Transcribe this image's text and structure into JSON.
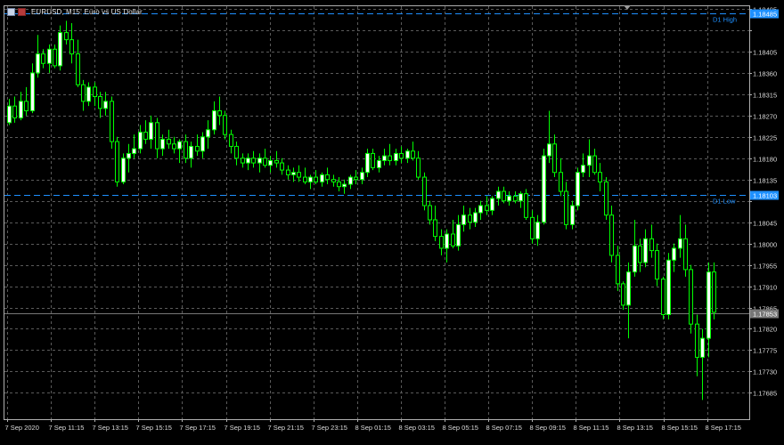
{
  "window": {
    "title": "EURUSD, M15:  Euro vs US Dollar"
  },
  "colors": {
    "background": "#000000",
    "grid": "#5a5a5a",
    "bull_candle": "#00ff00",
    "bull_body": "#ffffff",
    "bear_candle": "#00ff00",
    "axis_text": "#dcdcdc",
    "level_line": "#1e90ff",
    "level_label": "#1e90ff",
    "price_tag_bg": "#1e90ff",
    "bid_line": "#777777",
    "bid_tag_bg": "#777777"
  },
  "chart_data": {
    "type": "candlestick",
    "symbol": "EURUSD",
    "timeframe": "M15",
    "ylim": [
      1.17635,
      1.18495
    ],
    "y_ticks": [
      1.18495,
      1.1845,
      1.18405,
      1.1836,
      1.18315,
      1.1827,
      1.18225,
      1.1818,
      1.18135,
      1.1809,
      1.18045,
      1.18,
      1.17955,
      1.1791,
      1.17865,
      1.1782,
      1.17775,
      1.1773,
      1.17685
    ],
    "y_tick_labels": [
      "1.18495",
      "",
      "1.18405",
      "1.18360",
      "1.18315",
      "1.18270",
      "1.18225",
      "1.18180",
      "1.18135",
      "",
      "1.18045",
      "1.18000",
      "1.17955",
      "1.17910",
      "1.17865",
      "1.17820",
      "1.17775",
      "1.17730",
      "1.17685"
    ],
    "x_labels": [
      "7 Sep 2020",
      "7 Sep 11:15",
      "7 Sep 13:15",
      "7 Sep 15:15",
      "7 Sep 17:15",
      "7 Sep 19:15",
      "7 Sep 21:15",
      "7 Sep 23:15",
      "8 Sep 01:15",
      "8 Sep 03:15",
      "8 Sep 05:15",
      "8 Sep 07:15",
      "8 Sep 09:15",
      "8 Sep 11:15",
      "8 Sep 13:15",
      "8 Sep 15:15",
      "8 Sep 17:15"
    ],
    "grid": true,
    "levels": [
      {
        "name": "D1 High",
        "value": 1.18485,
        "label": "D1 High",
        "tag": "1.18485"
      },
      {
        "name": "D1 Low",
        "value": 1.18103,
        "label": "D1 Low",
        "tag": "1.18103"
      }
    ],
    "bid": {
      "value": 1.17853,
      "tag": "1.17853"
    },
    "candles": [
      [
        1.18255,
        1.18305,
        1.1825,
        1.1829
      ],
      [
        1.1829,
        1.1831,
        1.18255,
        1.18265
      ],
      [
        1.18265,
        1.1832,
        1.1826,
        1.183
      ],
      [
        1.183,
        1.1833,
        1.1827,
        1.1828
      ],
      [
        1.1828,
        1.1838,
        1.18275,
        1.1836
      ],
      [
        1.1836,
        1.1844,
        1.1835,
        1.184
      ],
      [
        1.184,
        1.1841,
        1.1837,
        1.1838
      ],
      [
        1.1838,
        1.1842,
        1.1836,
        1.1841
      ],
      [
        1.1841,
        1.1842,
        1.1837,
        1.18375
      ],
      [
        1.18375,
        1.1846,
        1.18365,
        1.18445
      ],
      [
        1.18445,
        1.1847,
        1.1842,
        1.1843
      ],
      [
        1.1843,
        1.18465,
        1.1838,
        1.184
      ],
      [
        1.184,
        1.1843,
        1.1833,
        1.18335
      ],
      [
        1.18335,
        1.18345,
        1.1828,
        1.183
      ],
      [
        1.183,
        1.1834,
        1.1829,
        1.1833
      ],
      [
        1.1833,
        1.1834,
        1.1829,
        1.1831
      ],
      [
        1.1831,
        1.1832,
        1.18265,
        1.18285
      ],
      [
        1.18285,
        1.1832,
        1.1827,
        1.183
      ],
      [
        1.183,
        1.1831,
        1.182,
        1.18215
      ],
      [
        1.18215,
        1.18225,
        1.1812,
        1.1813
      ],
      [
        1.1813,
        1.1819,
        1.18125,
        1.1818
      ],
      [
        1.1818,
        1.1821,
        1.1815,
        1.1819
      ],
      [
        1.1819,
        1.1823,
        1.1818,
        1.182
      ],
      [
        1.182,
        1.1825,
        1.1819,
        1.18235
      ],
      [
        1.18235,
        1.1826,
        1.1821,
        1.1822
      ],
      [
        1.1822,
        1.1827,
        1.182,
        1.18255
      ],
      [
        1.18255,
        1.18265,
        1.1818,
        1.182
      ],
      [
        1.182,
        1.1823,
        1.18185,
        1.1822
      ],
      [
        1.1822,
        1.1824,
        1.182,
        1.1821
      ],
      [
        1.1821,
        1.18225,
        1.1819,
        1.182
      ],
      [
        1.182,
        1.1822,
        1.1817,
        1.18215
      ],
      [
        1.18215,
        1.1823,
        1.1817,
        1.1818
      ],
      [
        1.1818,
        1.18215,
        1.1816,
        1.18205
      ],
      [
        1.18205,
        1.1823,
        1.18185,
        1.18195
      ],
      [
        1.18195,
        1.18235,
        1.1818,
        1.18225
      ],
      [
        1.18225,
        1.1826,
        1.182,
        1.1824
      ],
      [
        1.1824,
        1.183,
        1.1823,
        1.1828
      ],
      [
        1.1828,
        1.1831,
        1.1825,
        1.1827
      ],
      [
        1.1827,
        1.1828,
        1.1822,
        1.1823
      ],
      [
        1.1823,
        1.1824,
        1.1819,
        1.18205
      ],
      [
        1.18205,
        1.18215,
        1.18165,
        1.1818
      ],
      [
        1.1818,
        1.1819,
        1.1816,
        1.1817
      ],
      [
        1.1817,
        1.1819,
        1.18155,
        1.1818
      ],
      [
        1.1818,
        1.18195,
        1.1816,
        1.1817
      ],
      [
        1.1817,
        1.1819,
        1.1815,
        1.1818
      ],
      [
        1.1818,
        1.182,
        1.1816,
        1.18165
      ],
      [
        1.18165,
        1.18185,
        1.1815,
        1.18175
      ],
      [
        1.18175,
        1.18195,
        1.1816,
        1.1817
      ],
      [
        1.1817,
        1.1818,
        1.18145,
        1.18155
      ],
      [
        1.18155,
        1.18165,
        1.18135,
        1.18145
      ],
      [
        1.18145,
        1.1816,
        1.1813,
        1.1815
      ],
      [
        1.1815,
        1.18165,
        1.1813,
        1.1814
      ],
      [
        1.1814,
        1.1816,
        1.18125,
        1.1813
      ],
      [
        1.1813,
        1.18145,
        1.18115,
        1.1814
      ],
      [
        1.1814,
        1.18155,
        1.18125,
        1.1813
      ],
      [
        1.1813,
        1.1815,
        1.1812,
        1.18145
      ],
      [
        1.18145,
        1.1816,
        1.18125,
        1.18135
      ],
      [
        1.18135,
        1.18145,
        1.1812,
        1.1813
      ],
      [
        1.1813,
        1.1814,
        1.1811,
        1.1812
      ],
      [
        1.1812,
        1.18135,
        1.18105,
        1.18125
      ],
      [
        1.18125,
        1.18145,
        1.18115,
        1.1814
      ],
      [
        1.1814,
        1.18155,
        1.18125,
        1.18135
      ],
      [
        1.18135,
        1.1816,
        1.18125,
        1.1815
      ],
      [
        1.1815,
        1.182,
        1.1814,
        1.1819
      ],
      [
        1.1819,
        1.182,
        1.18155,
        1.1816
      ],
      [
        1.1816,
        1.18185,
        1.1815,
        1.18175
      ],
      [
        1.18175,
        1.182,
        1.18165,
        1.18185
      ],
      [
        1.18185,
        1.1821,
        1.18165,
        1.18175
      ],
      [
        1.18175,
        1.182,
        1.18165,
        1.1819
      ],
      [
        1.1819,
        1.18205,
        1.1817,
        1.1818
      ],
      [
        1.1818,
        1.182,
        1.1817,
        1.18195
      ],
      [
        1.18195,
        1.18215,
        1.18175,
        1.1818
      ],
      [
        1.1818,
        1.18195,
        1.18135,
        1.1814
      ],
      [
        1.1814,
        1.1815,
        1.1807,
        1.1808
      ],
      [
        1.1808,
        1.1809,
        1.1804,
        1.1805
      ],
      [
        1.1805,
        1.1808,
        1.18005,
        1.18015
      ],
      [
        1.18015,
        1.1803,
        1.17975,
        1.1799
      ],
      [
        1.1799,
        1.1803,
        1.1796,
        1.1802
      ],
      [
        1.1802,
        1.1805,
        1.1799,
        1.17995
      ],
      [
        1.17995,
        1.1806,
        1.17985,
        1.1804
      ],
      [
        1.1804,
        1.1808,
        1.18025,
        1.1806
      ],
      [
        1.1806,
        1.18075,
        1.1803,
        1.18045
      ],
      [
        1.18045,
        1.18075,
        1.18035,
        1.18065
      ],
      [
        1.18065,
        1.1809,
        1.1805,
        1.1808
      ],
      [
        1.1808,
        1.181,
        1.1806,
        1.1807
      ],
      [
        1.1807,
        1.181,
        1.1806,
        1.18095
      ],
      [
        1.18095,
        1.1812,
        1.1808,
        1.1811
      ],
      [
        1.1811,
        1.1812,
        1.18085,
        1.1809
      ],
      [
        1.1809,
        1.1811,
        1.1808,
        1.181
      ],
      [
        1.181,
        1.1811,
        1.18085,
        1.1809
      ],
      [
        1.1809,
        1.1811,
        1.18075,
        1.18105
      ],
      [
        1.18105,
        1.18115,
        1.1805,
        1.18055
      ],
      [
        1.18055,
        1.1807,
        1.18,
        1.1801
      ],
      [
        1.1801,
        1.1806,
        1.17995,
        1.18045
      ],
      [
        1.18045,
        1.182,
        1.1804,
        1.18185
      ],
      [
        1.18185,
        1.1828,
        1.1817,
        1.1821
      ],
      [
        1.1821,
        1.1823,
        1.1814,
        1.1815
      ],
      [
        1.1815,
        1.1818,
        1.181,
        1.1811
      ],
      [
        1.1811,
        1.1813,
        1.1803,
        1.1804
      ],
      [
        1.1804,
        1.1809,
        1.1803,
        1.1808
      ],
      [
        1.1808,
        1.1816,
        1.1807,
        1.1815
      ],
      [
        1.1815,
        1.1819,
        1.1814,
        1.18165
      ],
      [
        1.18165,
        1.1822,
        1.1814,
        1.18185
      ],
      [
        1.18185,
        1.182,
        1.18145,
        1.1815
      ],
      [
        1.1815,
        1.1817,
        1.1811,
        1.1813
      ],
      [
        1.1813,
        1.1814,
        1.1805,
        1.1806
      ],
      [
        1.1806,
        1.1808,
        1.1796,
        1.17975
      ],
      [
        1.17975,
        1.17995,
        1.179,
        1.17915
      ],
      [
        1.17915,
        1.1792,
        1.1786,
        1.1787
      ],
      [
        1.1787,
        1.1796,
        1.178,
        1.1794
      ],
      [
        1.1794,
        1.1805,
        1.1793,
        1.17995
      ],
      [
        1.17995,
        1.1801,
        1.1794,
        1.1796
      ],
      [
        1.1796,
        1.1803,
        1.1795,
        1.1801
      ],
      [
        1.1801,
        1.1804,
        1.1797,
        1.17985
      ],
      [
        1.17985,
        1.18,
        1.1791,
        1.17925
      ],
      [
        1.17925,
        1.1793,
        1.1784,
        1.1785
      ],
      [
        1.1785,
        1.1798,
        1.1784,
        1.17965
      ],
      [
        1.17965,
        1.18,
        1.1794,
        1.1799
      ],
      [
        1.1799,
        1.1806,
        1.1797,
        1.1801
      ],
      [
        1.1801,
        1.1804,
        1.1793,
        1.17945
      ],
      [
        1.17945,
        1.17955,
        1.1781,
        1.1783
      ],
      [
        1.1783,
        1.1785,
        1.1772,
        1.1776
      ],
      [
        1.1776,
        1.1782,
        1.1767,
        1.178
      ],
      [
        1.178,
        1.1796,
        1.1776,
        1.1794
      ],
      [
        1.1794,
        1.1796,
        1.1784,
        1.17855
      ]
    ]
  }
}
